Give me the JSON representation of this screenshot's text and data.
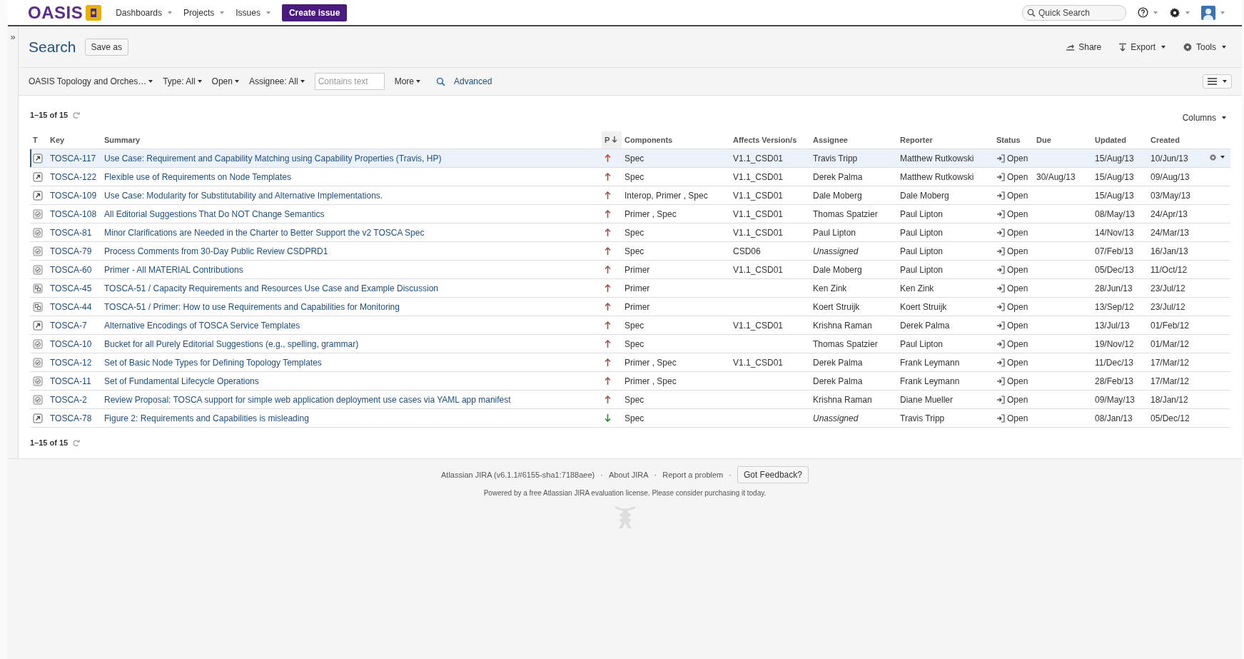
{
  "header": {
    "logo": "OASIS",
    "nav": [
      {
        "label": "Dashboards"
      },
      {
        "label": "Projects"
      },
      {
        "label": "Issues"
      }
    ],
    "create_button": "Create issue",
    "search": {
      "placeholder": "Quick Search"
    }
  },
  "sidebar": {
    "toggle": "»"
  },
  "page": {
    "title": "Search",
    "save_button": "Save as",
    "actions": [
      {
        "label": "Share",
        "kind": "share"
      },
      {
        "label": "Export",
        "kind": "export"
      },
      {
        "label": "Tools",
        "kind": "tools"
      }
    ]
  },
  "filters": [
    {
      "label": "OASIS Topology and Orches…"
    },
    {
      "label": "Type: All"
    },
    {
      "label": "Open"
    },
    {
      "label": "Assignee: All"
    }
  ],
  "text_filter": {
    "placeholder": "Contains text"
  },
  "more_button": "More",
  "advanced_link": "Advanced",
  "results": {
    "count": "1–15 of 15",
    "columns_button": "Columns",
    "footer_count": "1–15 of 15",
    "columns": [
      {
        "label": "T",
        "sorted": false
      },
      {
        "label": "Key",
        "sorted": false
      },
      {
        "label": "Summary",
        "sorted": false
      },
      {
        "label": "P",
        "sorted": true
      },
      {
        "label": "Components",
        "sorted": false
      },
      {
        "label": "Affects Version/s",
        "sorted": false
      },
      {
        "label": "Assignee",
        "sorted": false
      },
      {
        "label": "Reporter",
        "sorted": false
      },
      {
        "label": "Status",
        "sorted": false
      },
      {
        "label": "Due",
        "sorted": false
      },
      {
        "label": "Updated",
        "sorted": false
      },
      {
        "label": "Created",
        "sorted": false
      }
    ],
    "rows": [
      {
        "issue_type": {
          "kind": "improvement"
        },
        "key": "TOSCA-117",
        "summary": "Use Case: Requirement and Capability Matching using Capability Properties (Travis, HP)",
        "priority": {
          "kind": "critical"
        },
        "components": "Spec",
        "version": "V1.1_CSD01",
        "assignee": "Travis Tripp",
        "unassigned": false,
        "reporter": "Matthew Rutkowski",
        "status": "Open",
        "updated": "15/Aug/13",
        "created": "10/Jun/13",
        "selected": true
      },
      {
        "issue_type": {
          "kind": "improvement"
        },
        "key": "TOSCA-122",
        "summary": "Flexible use of Requirements on Node Templates",
        "priority": {
          "kind": "major"
        },
        "components": "Spec",
        "version": "V1.1_CSD01",
        "assignee": "Derek Palma",
        "unassigned": false,
        "reporter": "Matthew Rutkowski",
        "status": "Open",
        "due": "30/Aug/13",
        "updated": "15/Aug/13",
        "created": "09/Aug/13",
        "selected": false
      },
      {
        "issue_type": {
          "kind": "improvement"
        },
        "key": "TOSCA-109",
        "summary": "Use Case: Modularity for Substitutability and Alternative Implementations.",
        "priority": {
          "kind": "major"
        },
        "components": "Interop, Primer , Spec",
        "version": "V1.1_CSD01",
        "assignee": "Dale Moberg",
        "unassigned": false,
        "reporter": "Dale Moberg",
        "status": "Open",
        "updated": "15/Aug/13",
        "created": "03/May/13",
        "selected": false
      },
      {
        "issue_type": {
          "kind": "task"
        },
        "key": "TOSCA-108",
        "summary": "All Editorial Suggestions That Do NOT Change Semantics",
        "priority": {
          "kind": "major"
        },
        "components": "Primer , Spec",
        "version": "V1.1_CSD01",
        "assignee": "Thomas Spatzier",
        "unassigned": false,
        "reporter": "Paul Lipton",
        "status": "Open",
        "updated": "08/May/13",
        "created": "24/Apr/13",
        "selected": false
      },
      {
        "issue_type": {
          "kind": "task"
        },
        "key": "TOSCA-81",
        "summary": "Minor Clarifications are Needed in the Charter to Better Support the v2 TOSCA Spec",
        "priority": {
          "kind": "major"
        },
        "components": "Spec",
        "version": "V1.1_CSD01",
        "assignee": "Paul Lipton",
        "unassigned": false,
        "reporter": "Paul Lipton",
        "status": "Open",
        "updated": "14/Nov/13",
        "created": "24/Mar/13",
        "selected": false
      },
      {
        "issue_type": {
          "kind": "task"
        },
        "key": "TOSCA-79",
        "summary": "Process Comments from 30-Day Public Review CSDPRD1",
        "priority": {
          "kind": "major"
        },
        "components": "Spec",
        "version": "CSD06",
        "assignee": "Unassigned",
        "unassigned": true,
        "reporter": "Paul Lipton",
        "status": "Open",
        "updated": "07/Feb/13",
        "created": "16/Jan/13",
        "selected": false
      },
      {
        "issue_type": {
          "kind": "task"
        },
        "key": "TOSCA-60",
        "summary": "Primer - All MATERIAL Contributions",
        "priority": {
          "kind": "major"
        },
        "components": "Primer",
        "version": "V1.1_CSD01",
        "assignee": "Dale Moberg",
        "unassigned": false,
        "reporter": "Paul Lipton",
        "status": "Open",
        "updated": "05/Dec/13",
        "created": "11/Oct/12",
        "selected": false
      },
      {
        "issue_type": {
          "kind": "subtask"
        },
        "key": "TOSCA-45",
        "summary": "TOSCA-51 / Capacity Requirements and Resources Use Case and Example Discussion",
        "priority": {
          "kind": "major"
        },
        "components": "Primer",
        "assignee": "Ken Zink",
        "unassigned": false,
        "reporter": "Ken Zink",
        "status": "Open",
        "updated": "28/Jun/13",
        "created": "23/Jul/12",
        "selected": false
      },
      {
        "issue_type": {
          "kind": "subtask"
        },
        "key": "TOSCA-44",
        "summary": "TOSCA-51 / Primer: How to use Requirements and Capabilities for Monitoring",
        "priority": {
          "kind": "major"
        },
        "components": "Primer",
        "assignee": "Koert Struijk",
        "unassigned": false,
        "reporter": "Koert Struijk",
        "status": "Open",
        "updated": "13/Sep/12",
        "created": "23/Jul/12",
        "selected": false
      },
      {
        "issue_type": {
          "kind": "improvement"
        },
        "key": "TOSCA-7",
        "summary": "Alternative Encodings of TOSCA Service Templates",
        "priority": {
          "kind": "major"
        },
        "components": "Spec",
        "version": "V1.1_CSD01",
        "assignee": "Krishna Raman",
        "unassigned": false,
        "reporter": "Derek Palma",
        "status": "Open",
        "updated": "13/Jul/13",
        "created": "01/Feb/12",
        "selected": false
      },
      {
        "issue_type": {
          "kind": "task"
        },
        "key": "TOSCA-10",
        "summary": "Bucket for all Purely Editorial Suggestions (e.g., spelling, grammar)",
        "priority": {
          "kind": "major"
        },
        "components": "Spec",
        "assignee": "Thomas Spatzier",
        "unassigned": false,
        "reporter": "Paul Lipton",
        "status": "Open",
        "updated": "19/Nov/12",
        "created": "01/Mar/12",
        "selected": false
      },
      {
        "issue_type": {
          "kind": "task"
        },
        "key": "TOSCA-12",
        "summary": "Set of Basic Node Types for Defining Topology Templates",
        "priority": {
          "kind": "major"
        },
        "components": "Primer , Spec",
        "version": "V1.1_CSD01",
        "assignee": "Derek Palma",
        "unassigned": false,
        "reporter": "Frank Leymann",
        "status": "Open",
        "updated": "11/Dec/13",
        "created": "17/Mar/12",
        "selected": false
      },
      {
        "issue_type": {
          "kind": "task"
        },
        "key": "TOSCA-11",
        "summary": "Set of Fundamental Lifecycle Operations",
        "priority": {
          "kind": "major"
        },
        "components": "Primer , Spec",
        "assignee": "Derek Palma",
        "unassigned": false,
        "reporter": "Frank Leymann",
        "status": "Open",
        "updated": "28/Feb/13",
        "created": "17/Mar/12",
        "selected": false
      },
      {
        "issue_type": {
          "kind": "task"
        },
        "key": "TOSCA-2",
        "summary": "Review Proposal: TOSCA support for simple web application deployment use cases via YAML app manifest",
        "priority": {
          "kind": "major"
        },
        "components": "Spec",
        "assignee": "Krishna Raman",
        "unassigned": false,
        "reporter": "Diane Mueller",
        "status": "Open",
        "updated": "09/May/13",
        "created": "18/Jan/12",
        "selected": false
      },
      {
        "issue_type": {
          "kind": "improvement"
        },
        "key": "TOSCA-78",
        "summary": "Figure 2: Requirements and Capabilities is misleading",
        "priority": {
          "kind": "minor"
        },
        "components": "Spec",
        "assignee": "Unassigned",
        "unassigned": true,
        "reporter": "Travis Tripp",
        "status": "Open",
        "updated": "08/Jan/13",
        "created": "05/Dec/12",
        "selected": false
      }
    ]
  },
  "footer": {
    "items": [
      {
        "kind": "text",
        "label": "Atlassian JIRA (v6.1.1#6155-sha1:7188aee)"
      },
      {
        "kind": "separator",
        "label": "·"
      },
      {
        "kind": "link",
        "label": "About JIRA"
      },
      {
        "kind": "separator",
        "label": "·"
      },
      {
        "kind": "link",
        "label": "Report a problem"
      },
      {
        "kind": "separator",
        "label": "·"
      },
      {
        "kind": "button",
        "label": "Got Feedback?"
      }
    ],
    "license": "Powered by a free Atlassian JIRA evaluation license. Please consider purchasing it today."
  }
}
